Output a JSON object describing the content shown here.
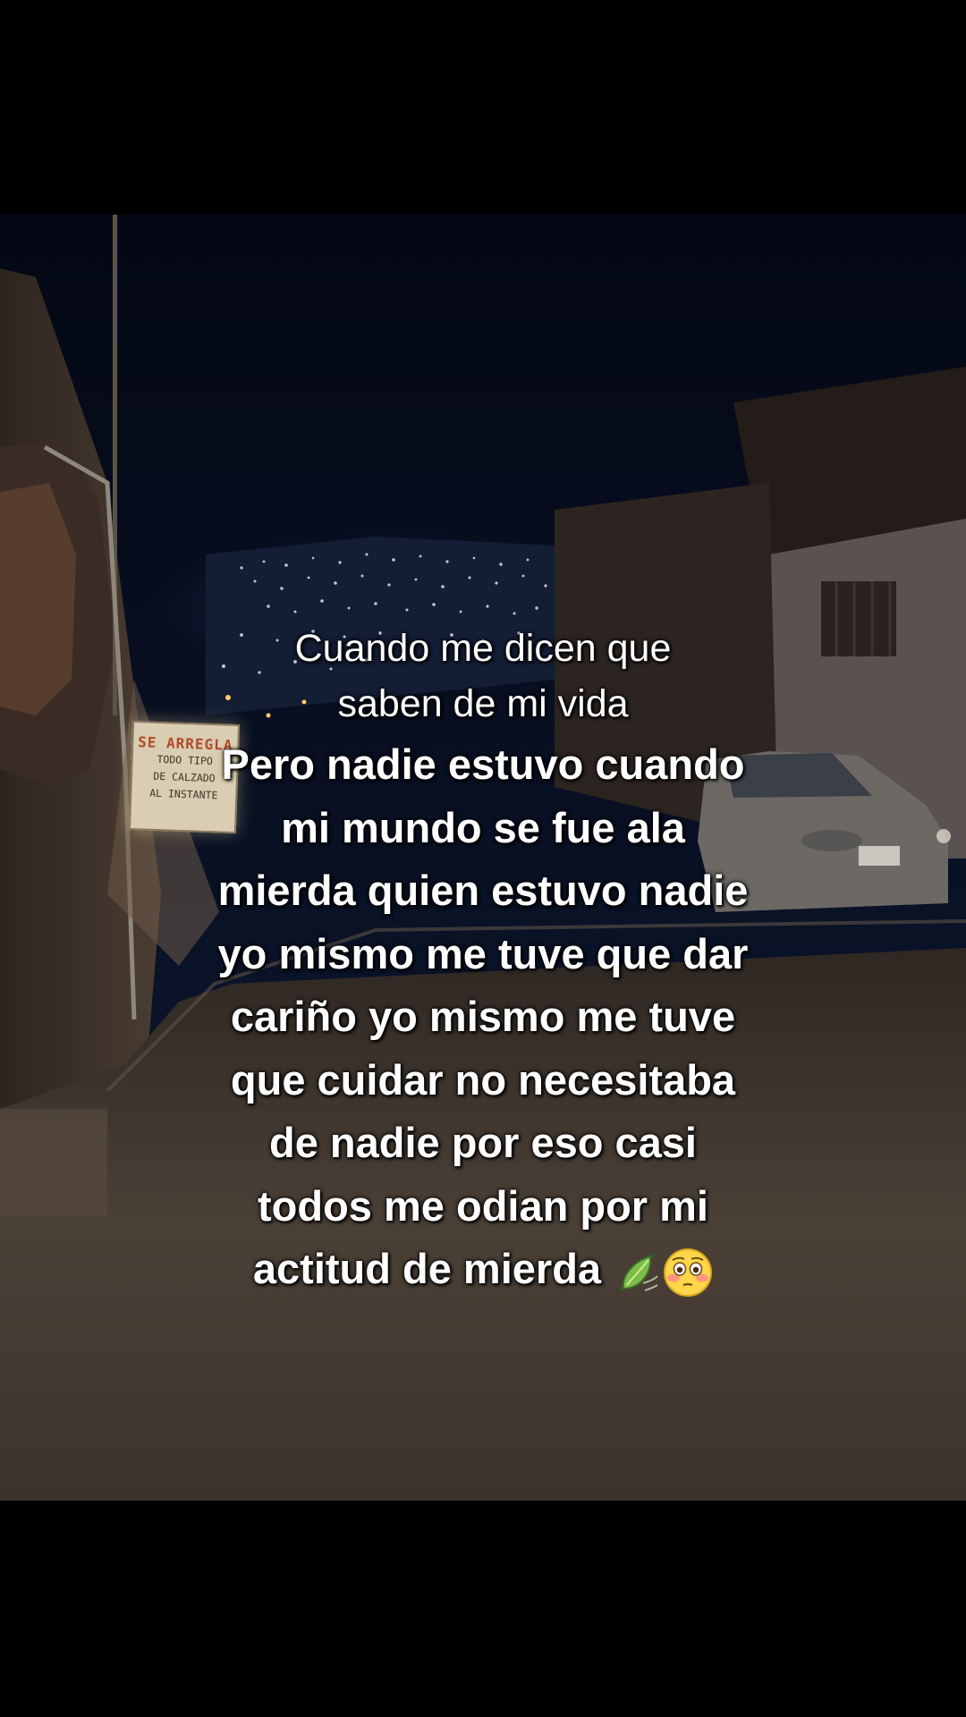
{
  "sign": {
    "line1": "SE ARREGLA",
    "line2": "TODO TIPO",
    "line3": "DE CALZADO",
    "line4": "AL INSTANTE"
  },
  "caption": {
    "intro": [
      "Cuando me dicen que",
      "saben de mi vida"
    ],
    "body": [
      "Pero nadie estuvo cuando",
      "mi mundo se fue ala",
      "mierda quien estuvo nadie",
      "yo mismo me tuve que dar",
      "cariño yo mismo me tuve",
      "que cuidar no necesitaba",
      "de nadie por eso casi",
      "todos me odian por mi",
      "actitud de mierda"
    ],
    "emojis": [
      "leaf-fluttering-in-wind",
      "flushed-face"
    ]
  }
}
